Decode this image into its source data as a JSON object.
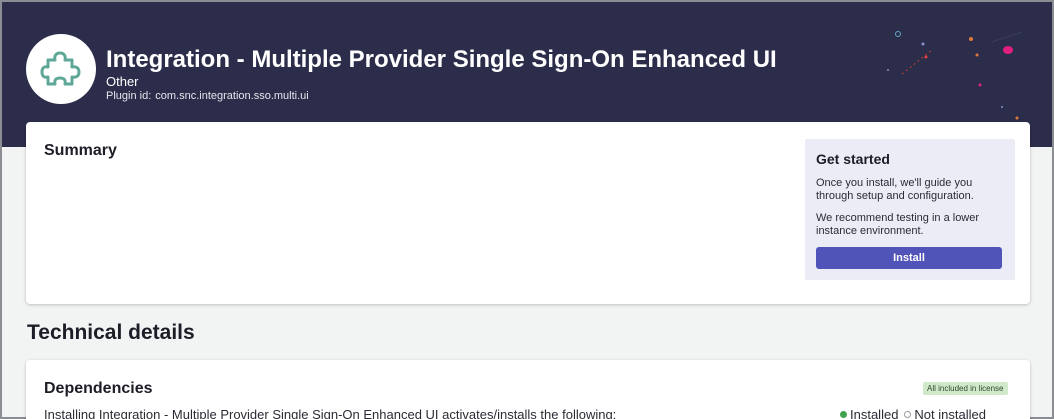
{
  "header": {
    "title": "Integration - Multiple Provider Single Sign-On Enhanced UI",
    "category": "Other",
    "plugin_id_label": "Plugin id:",
    "plugin_id": "com.snc.integration.sso.multi.ui",
    "logo_icon": "puzzle-piece-icon",
    "background_color": "#2c2d4a",
    "logo_color": "#5fa897"
  },
  "summary": {
    "title": "Summary"
  },
  "get_started": {
    "title": "Get started",
    "text1": "Once you install, we'll guide you through setup and configuration.",
    "text2": "We recommend testing in a lower instance environment.",
    "install_label": "Install",
    "button_color": "#5054b8"
  },
  "technical": {
    "heading": "Technical details"
  },
  "dependencies": {
    "title": "Dependencies",
    "license_badge": "All included in license",
    "description": "Installing Integration - Multiple Provider Single Sign-On Enhanced UI activates/installs the following:",
    "legend_installed": "Installed",
    "legend_not_installed": "Not installed"
  }
}
